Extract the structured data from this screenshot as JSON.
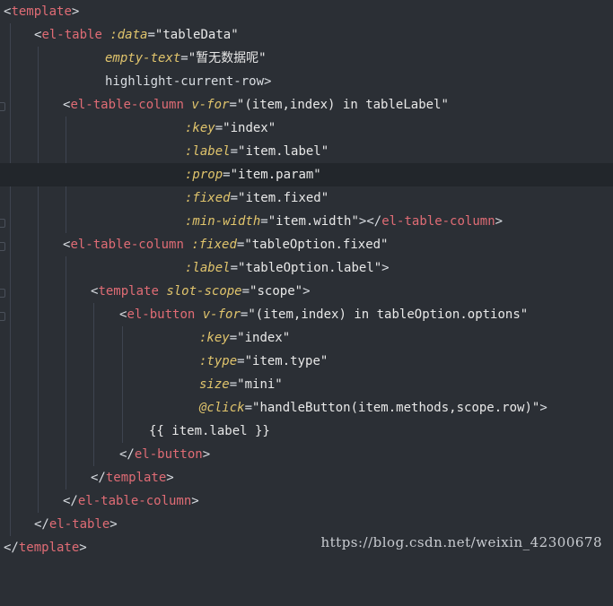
{
  "editor": {
    "lines": [
      {
        "indent": 0,
        "text": "<template>"
      },
      {
        "indent": 1,
        "text": "<el-table :data=\"tableData\""
      },
      {
        "indent": 3,
        "text": "empty-text=\"暂无数据呢\""
      },
      {
        "indent": 3,
        "text": "highlight-current-row>"
      },
      {
        "indent": 2,
        "text": "<el-table-column v-for=\"(item,index) in tableLabel\""
      },
      {
        "indent": 4,
        "text": ":key=\"index\""
      },
      {
        "indent": 4,
        "text": ":label=\"item.label\""
      },
      {
        "indent": 4,
        "text": ":prop=\"item.param\""
      },
      {
        "indent": 4,
        "text": ":fixed=\"item.fixed\""
      },
      {
        "indent": 4,
        "text": ":min-width=\"item.width\"></el-table-column>"
      },
      {
        "indent": 2,
        "text": "<el-table-column :fixed=\"tableOption.fixed\""
      },
      {
        "indent": 4,
        "text": ":label=\"tableOption.label\">"
      },
      {
        "indent": 3,
        "text": "<template slot-scope=\"scope\">"
      },
      {
        "indent": 4,
        "text": "<el-button v-for=\"(item,index) in tableOption.options\""
      },
      {
        "indent": 5,
        "text": ":key=\"index\""
      },
      {
        "indent": 5,
        "text": ":type=\"item.type\""
      },
      {
        "indent": 5,
        "text": "size=\"mini\""
      },
      {
        "indent": 5,
        "text": "@click=\"handleButton(item.methods,scope.row)\">"
      },
      {
        "indent": 5,
        "text": "{{ item.label }}"
      },
      {
        "indent": 4,
        "text": "</el-button>"
      },
      {
        "indent": 3,
        "text": "</template>"
      },
      {
        "indent": 2,
        "text": "</el-table-column>"
      },
      {
        "indent": 1,
        "text": "</el-table>"
      },
      {
        "indent": 0,
        "text": "</template>"
      }
    ]
  },
  "watermark": "https://blog.csdn.net/weixin_42300678"
}
